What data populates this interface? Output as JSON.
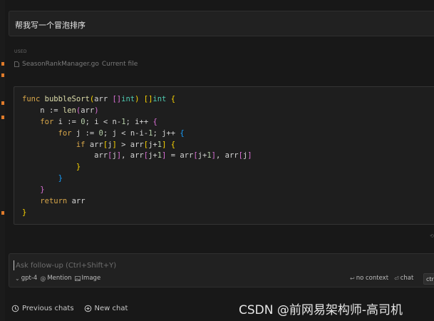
{
  "prompt": {
    "text": "帮我写一个冒泡排序"
  },
  "context": {
    "used_label": "USED",
    "file_name": "SeasonRankManager.go",
    "file_tag": "Current file"
  },
  "code": {
    "language": "go",
    "lines": [
      "func bubbleSort(arr []int) []int {",
      "    n := len(arr)",
      "    for i := 0; i < n-1; i++ {",
      "        for j := 0; j < n-i-1; j++ {",
      "            if arr[j] > arr[j+1] {",
      "                arr[j], arr[j+1] = arr[j+1], arr[j]",
      "            }",
      "        }",
      "    }",
      "    return arr",
      "}"
    ]
  },
  "followup": {
    "placeholder": "Ask follow-up (Ctrl+Shift+Y)",
    "model_label": "gpt-4",
    "mention_label": "Mention",
    "image_label": "Image",
    "no_context_label": "no context",
    "chat_label": "chat",
    "shortcut_label": "ctrl+"
  },
  "bottom": {
    "previous_chats": "Previous chats",
    "new_chat": "New chat"
  },
  "watermark": "CSDN @前网易架构师-高司机",
  "colors": {
    "background": "#181818",
    "panel": "#212121",
    "code_bg": "#1e1e1e",
    "keyword": "#d9a74a",
    "type": "#4ec9b0",
    "marker": "#e07b2a"
  },
  "icons": [
    "chevron-down-icon",
    "at-icon",
    "image-icon",
    "no-context-icon",
    "chat-icon",
    "history-icon",
    "plus-circle-icon",
    "file-icon"
  ]
}
